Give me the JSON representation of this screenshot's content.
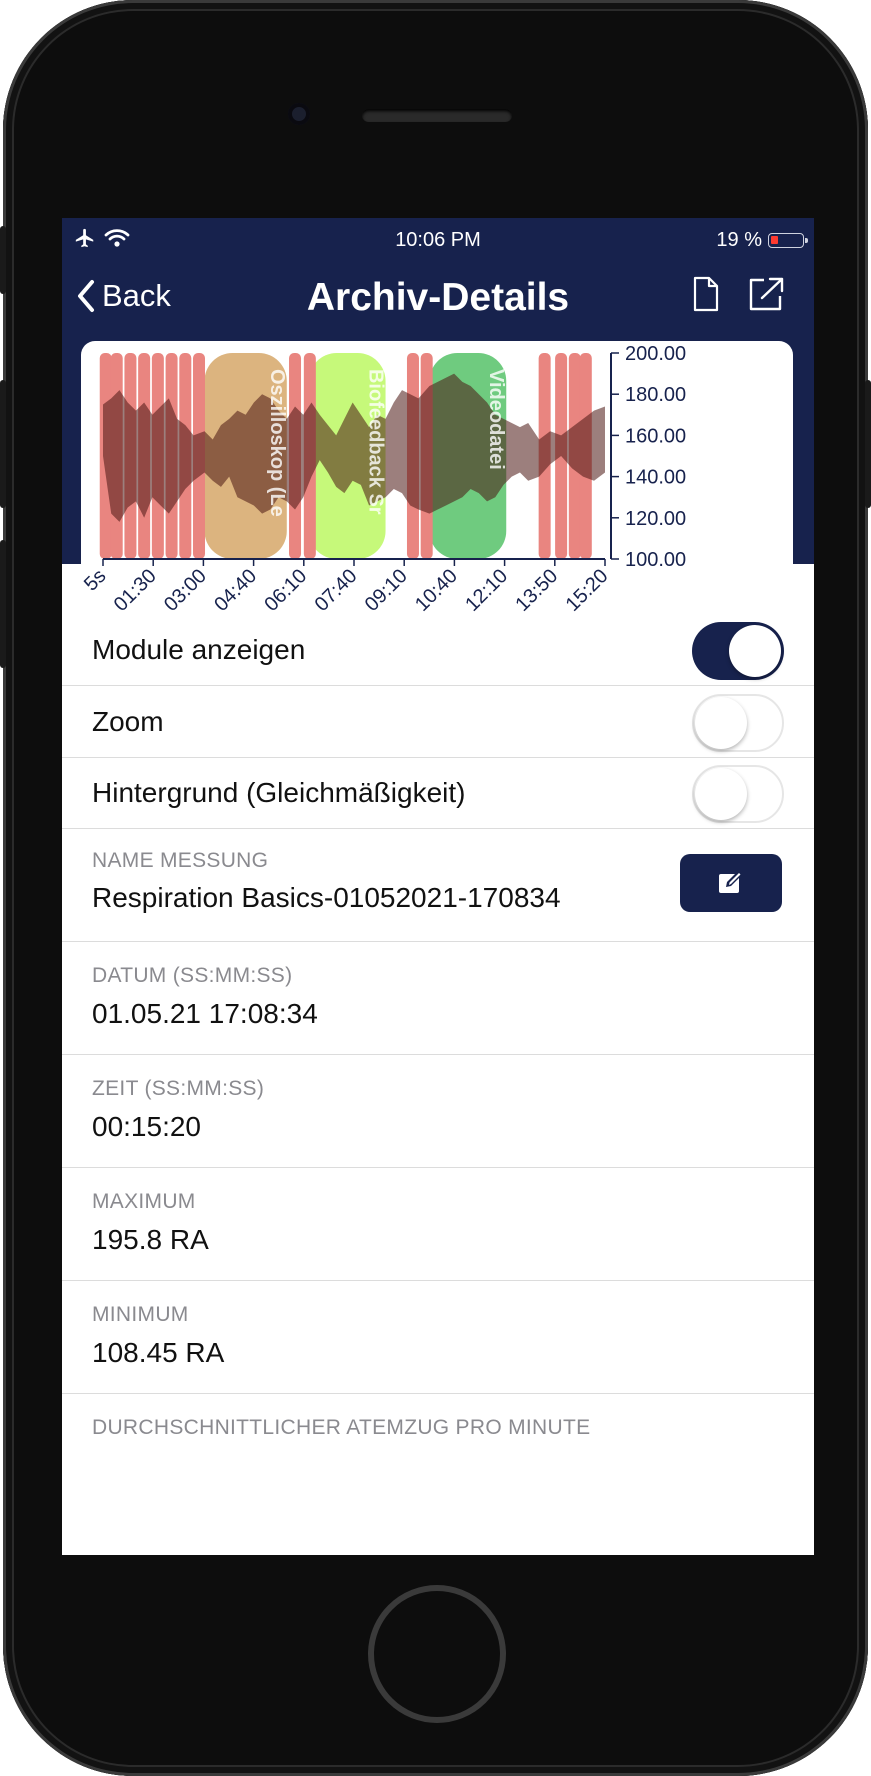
{
  "status_bar": {
    "time": "10:06 PM",
    "battery": "19 %",
    "battery_level": 0.19
  },
  "nav": {
    "back_label": "Back",
    "title": "Archiv-Details"
  },
  "chart_data": {
    "type": "area",
    "x_tick_labels": [
      "5s",
      "01:30",
      "03:00",
      "04:40",
      "06:10",
      "07:40",
      "09:10",
      "10:40",
      "12:10",
      "13:50",
      "15:20"
    ],
    "y_ticks": [
      "200.00",
      "180.00",
      "160.00",
      "140.00",
      "120.00",
      "100.00"
    ],
    "ylim": [
      100,
      200
    ],
    "xlim_seconds": [
      5,
      920
    ],
    "modules": [
      {
        "label": "Oszilloskop (Le",
        "start_s": 190,
        "end_s": 340,
        "color": "#dcb47f"
      },
      {
        "label": "Biofeedback Sr",
        "start_s": 380,
        "end_s": 520,
        "color": "#c6f97a"
      },
      {
        "label": "Videodatei",
        "start_s": 600,
        "end_s": 740,
        "color": "#6fcb7f"
      }
    ],
    "series": [
      {
        "values": [
          [
            5,
            150,
            175
          ],
          [
            20,
            122,
            178
          ],
          [
            35,
            118,
            182
          ],
          [
            50,
            125,
            176
          ],
          [
            65,
            128,
            172
          ],
          [
            80,
            120,
            176
          ],
          [
            95,
            130,
            170
          ],
          [
            110,
            126,
            174
          ],
          [
            125,
            122,
            178
          ],
          [
            140,
            128,
            168
          ],
          [
            155,
            134,
            165
          ],
          [
            170,
            138,
            160
          ],
          [
            190,
            142,
            162
          ],
          [
            205,
            138,
            158
          ],
          [
            220,
            135,
            165
          ],
          [
            235,
            140,
            168
          ],
          [
            250,
            130,
            172
          ],
          [
            265,
            128,
            170
          ],
          [
            280,
            126,
            176
          ],
          [
            295,
            122,
            180
          ],
          [
            310,
            124,
            178
          ],
          [
            325,
            130,
            172
          ],
          [
            340,
            128,
            168
          ],
          [
            355,
            124,
            174
          ],
          [
            370,
            130,
            170
          ],
          [
            385,
            140,
            176
          ],
          [
            400,
            148,
            170
          ],
          [
            415,
            142,
            165
          ],
          [
            430,
            135,
            160
          ],
          [
            445,
            132,
            168
          ],
          [
            460,
            138,
            176
          ],
          [
            475,
            136,
            170
          ],
          [
            490,
            126,
            164
          ],
          [
            505,
            128,
            170
          ],
          [
            520,
            130,
            168
          ],
          [
            535,
            134,
            176
          ],
          [
            550,
            132,
            182
          ],
          [
            565,
            126,
            180
          ],
          [
            580,
            124,
            178
          ],
          [
            600,
            122,
            184
          ],
          [
            615,
            124,
            186
          ],
          [
            630,
            126,
            188
          ],
          [
            645,
            128,
            190
          ],
          [
            660,
            130,
            186
          ],
          [
            675,
            134,
            184
          ],
          [
            690,
            132,
            180
          ],
          [
            705,
            128,
            176
          ],
          [
            720,
            130,
            170
          ],
          [
            735,
            136,
            168
          ],
          [
            750,
            140,
            166
          ],
          [
            765,
            142,
            164
          ],
          [
            780,
            138,
            166
          ],
          [
            800,
            140,
            158
          ],
          [
            820,
            146,
            162
          ],
          [
            840,
            150,
            160
          ],
          [
            860,
            144,
            164
          ],
          [
            880,
            140,
            168
          ],
          [
            900,
            138,
            172
          ],
          [
            920,
            142,
            174
          ]
        ]
      }
    ],
    "red_markers_s": [
      10,
      30,
      55,
      80,
      105,
      130,
      155,
      180,
      355,
      382,
      570,
      595,
      810,
      840,
      865,
      885
    ]
  },
  "settings": {
    "show_modules": {
      "label": "Module anzeigen",
      "on": true
    },
    "zoom": {
      "label": "Zoom",
      "on": false
    },
    "background": {
      "label": "Hintergrund (Gleichmäßigkeit)",
      "on": false
    }
  },
  "details": {
    "name": {
      "label": "NAME MESSUNG",
      "value": "Respiration Basics-01052021-170834"
    },
    "date": {
      "label": "DATUM (SS:MM:SS)",
      "value": "01.05.21 17:08:34"
    },
    "time": {
      "label": "ZEIT (SS:MM:SS)",
      "value": "00:15:20"
    },
    "maximum": {
      "label": "MAXIMUM",
      "value": "195.8 RA"
    },
    "minimum": {
      "label": "MINIMUM",
      "value": "108.45 RA"
    },
    "avg_breath": {
      "label": "DURCHSCHNITTLICHER ATEMZUG PRO MINUTE"
    }
  }
}
